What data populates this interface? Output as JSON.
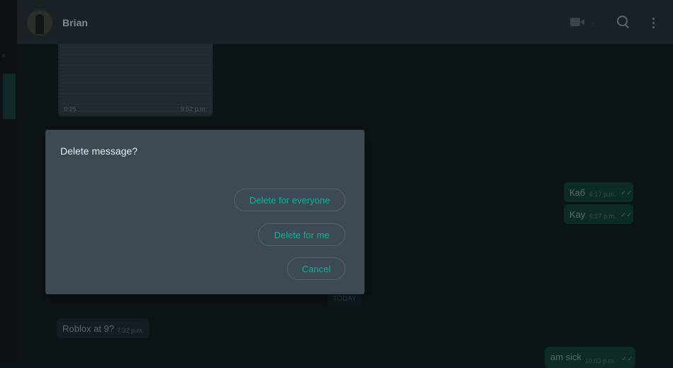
{
  "header": {
    "contact_name": "Brian",
    "icons": [
      "video-call-icon",
      "chevron-down-icon",
      "search-icon",
      "more-options-icon"
    ]
  },
  "messages": {
    "video": {
      "duration": "0:25",
      "time": "9:52 p.m."
    },
    "outgoing": [
      {
        "text": "Каб",
        "time": "6:17 p.m."
      },
      {
        "text": "Kay",
        "time": "6:17 p.m."
      },
      {
        "text": "am sick",
        "time": "10:03 p.m."
      }
    ],
    "date_divider": "TODAY",
    "incoming": [
      {
        "text": "Roblox at 9?",
        "time": "7:32 p.m."
      }
    ]
  },
  "dialog": {
    "title": "Delete message?",
    "delete_everyone_label": "Delete for everyone",
    "delete_me_label": "Delete for me",
    "cancel_label": "Cancel"
  },
  "colors": {
    "accent": "#11b497",
    "dialog_bg": "#3b4a53",
    "app_bg": "#0b141a"
  }
}
